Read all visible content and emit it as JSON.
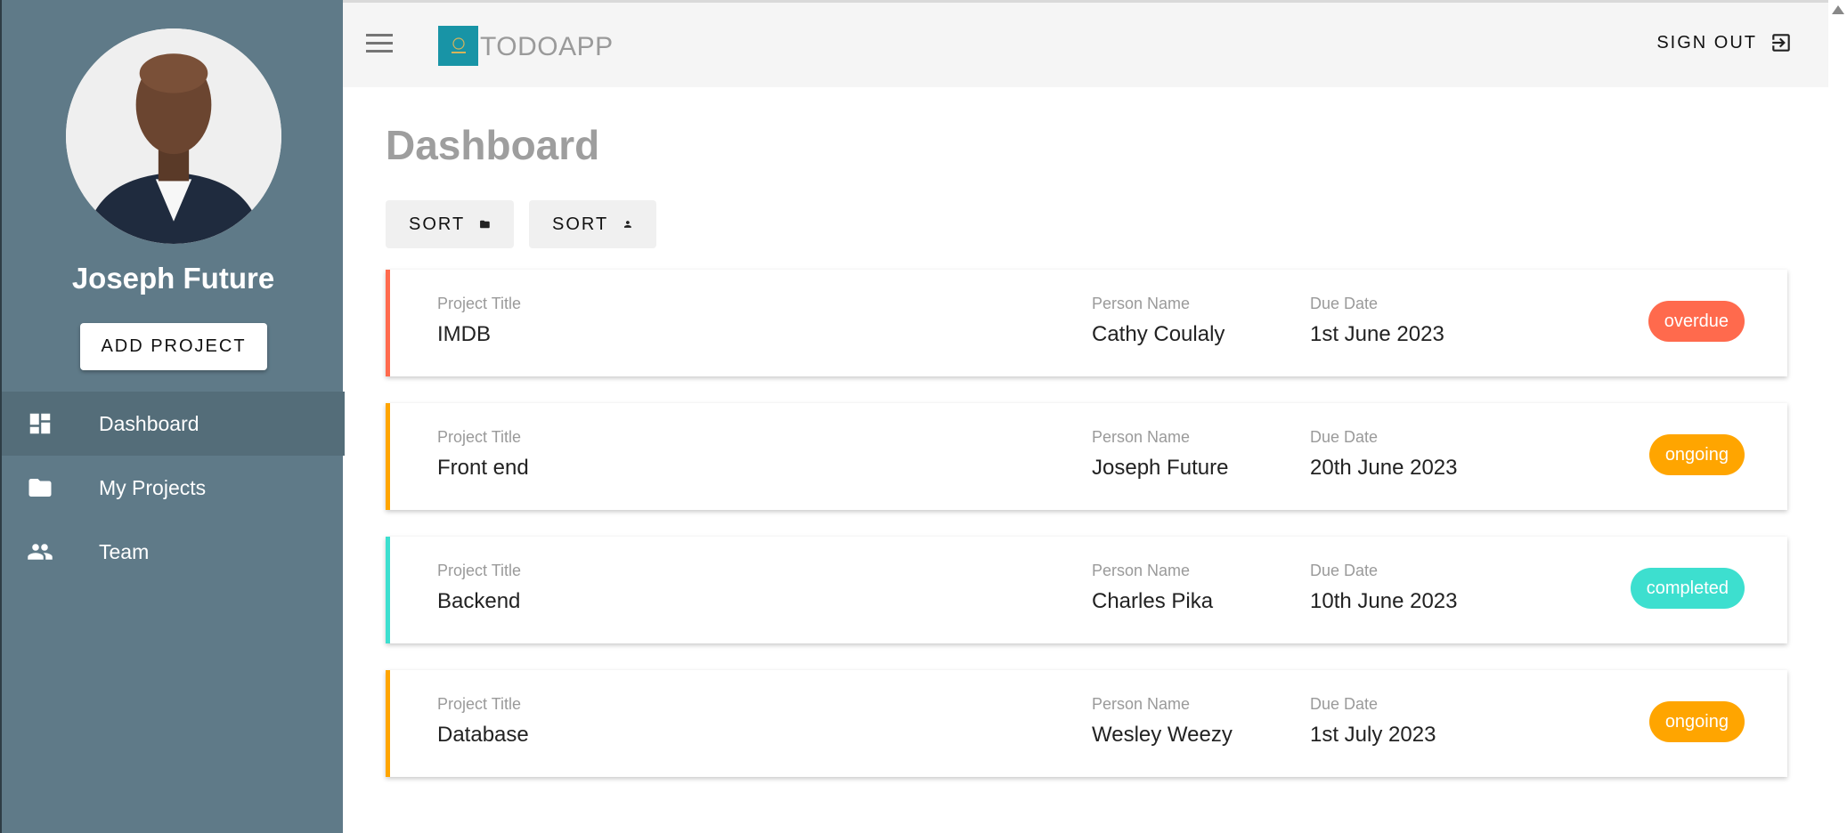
{
  "sidebar": {
    "user_name": "Joseph Future",
    "add_project_label": "ADD PROJECT",
    "items": [
      {
        "label": "Dashboard",
        "icon": "dashboard-icon",
        "active": true
      },
      {
        "label": "My Projects",
        "icon": "folder-icon",
        "active": false
      },
      {
        "label": "Team",
        "icon": "people-icon",
        "active": false
      }
    ]
  },
  "header": {
    "brand": "TODOAPP",
    "sign_out_label": "SIGN OUT"
  },
  "main": {
    "title": "Dashboard",
    "sort_buttons": [
      {
        "label": "SORT",
        "icon": "folder-icon"
      },
      {
        "label": "SORT",
        "icon": "person-icon"
      }
    ],
    "field_labels": {
      "title": "Project Title",
      "person": "Person Name",
      "due": "Due Date"
    },
    "projects": [
      {
        "title": "IMDB",
        "person": "Cathy Coulaly",
        "due": "1st June 2023",
        "status": "overdue"
      },
      {
        "title": "Front end",
        "person": "Joseph Future",
        "due": "20th June 2023",
        "status": "ongoing"
      },
      {
        "title": "Backend",
        "person": "Charles Pika",
        "due": "10th June 2023",
        "status": "completed"
      },
      {
        "title": "Database",
        "person": "Wesley Weezy",
        "due": "1st July 2023",
        "status": "ongoing"
      }
    ]
  },
  "colors": {
    "sidebar_bg": "#5f7a88",
    "overdue": "#ff6a4d",
    "ongoing": "#ffa500",
    "completed": "#3ddfcf"
  }
}
